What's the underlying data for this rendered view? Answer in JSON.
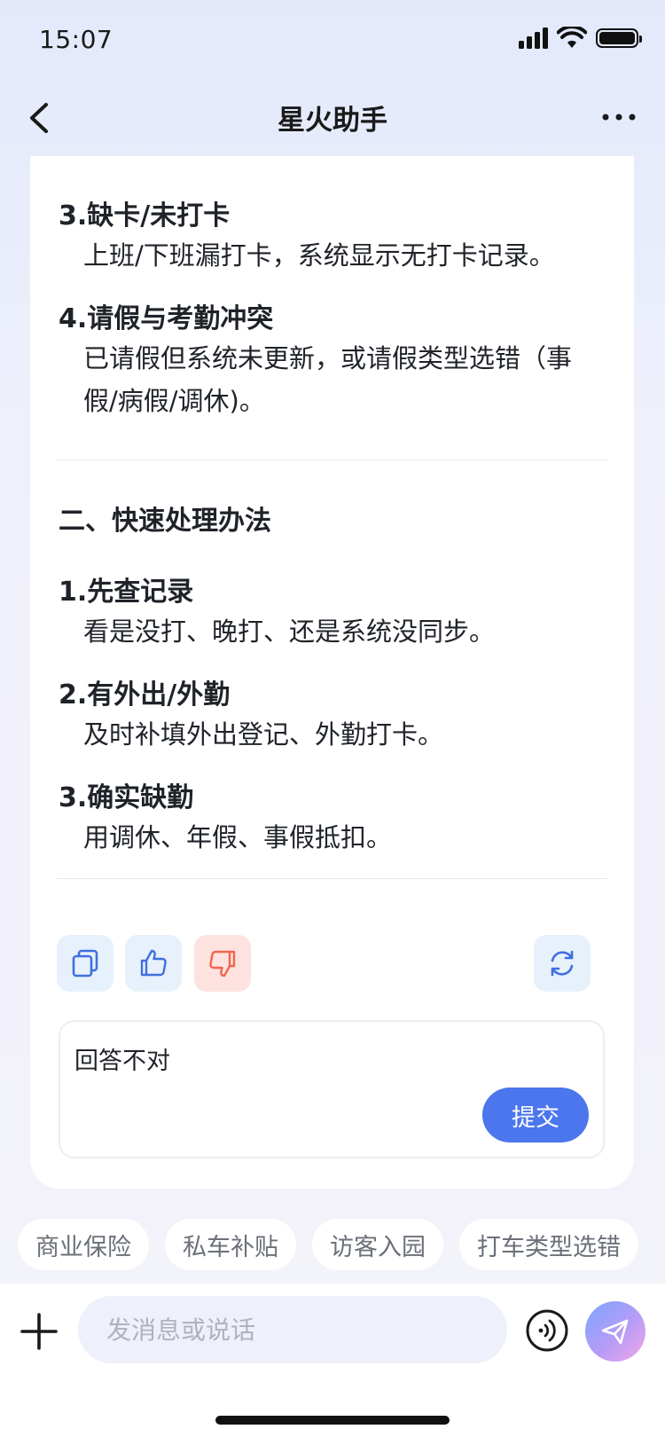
{
  "status_bar": {
    "time": "15:07"
  },
  "nav": {
    "title": "星火助手"
  },
  "content": {
    "items_top": [
      {
        "title": "3.缺卡/未打卡",
        "desc": "上班/下班漏打卡，系统显示无打卡记录。"
      },
      {
        "title": "4.请假与考勤冲突",
        "desc": "已请假但系统未更新，或请假类型选错（事假/病假/调休)。"
      }
    ],
    "section2_title": "二、快速处理办法",
    "items_section2": [
      {
        "title": "1.先查记录",
        "desc": "看是没打、晚打、还是系统没同步。"
      },
      {
        "title": "2.有外出/外勤",
        "desc": "及时补填外出登记、外勤打卡。"
      },
      {
        "title": "3.确实缺勤",
        "desc": "用调休、年假、事假抵扣。"
      }
    ]
  },
  "feedback": {
    "text": "回答不对",
    "submit_label": "提交"
  },
  "chips": [
    "商业保险",
    "私车补贴",
    "访客入园",
    "打车类型选错"
  ],
  "input": {
    "placeholder": "发消息或说话"
  },
  "colors": {
    "accent": "#4b76ee",
    "dislike": "#f0664d",
    "icon_blue": "#3f6fe0"
  }
}
